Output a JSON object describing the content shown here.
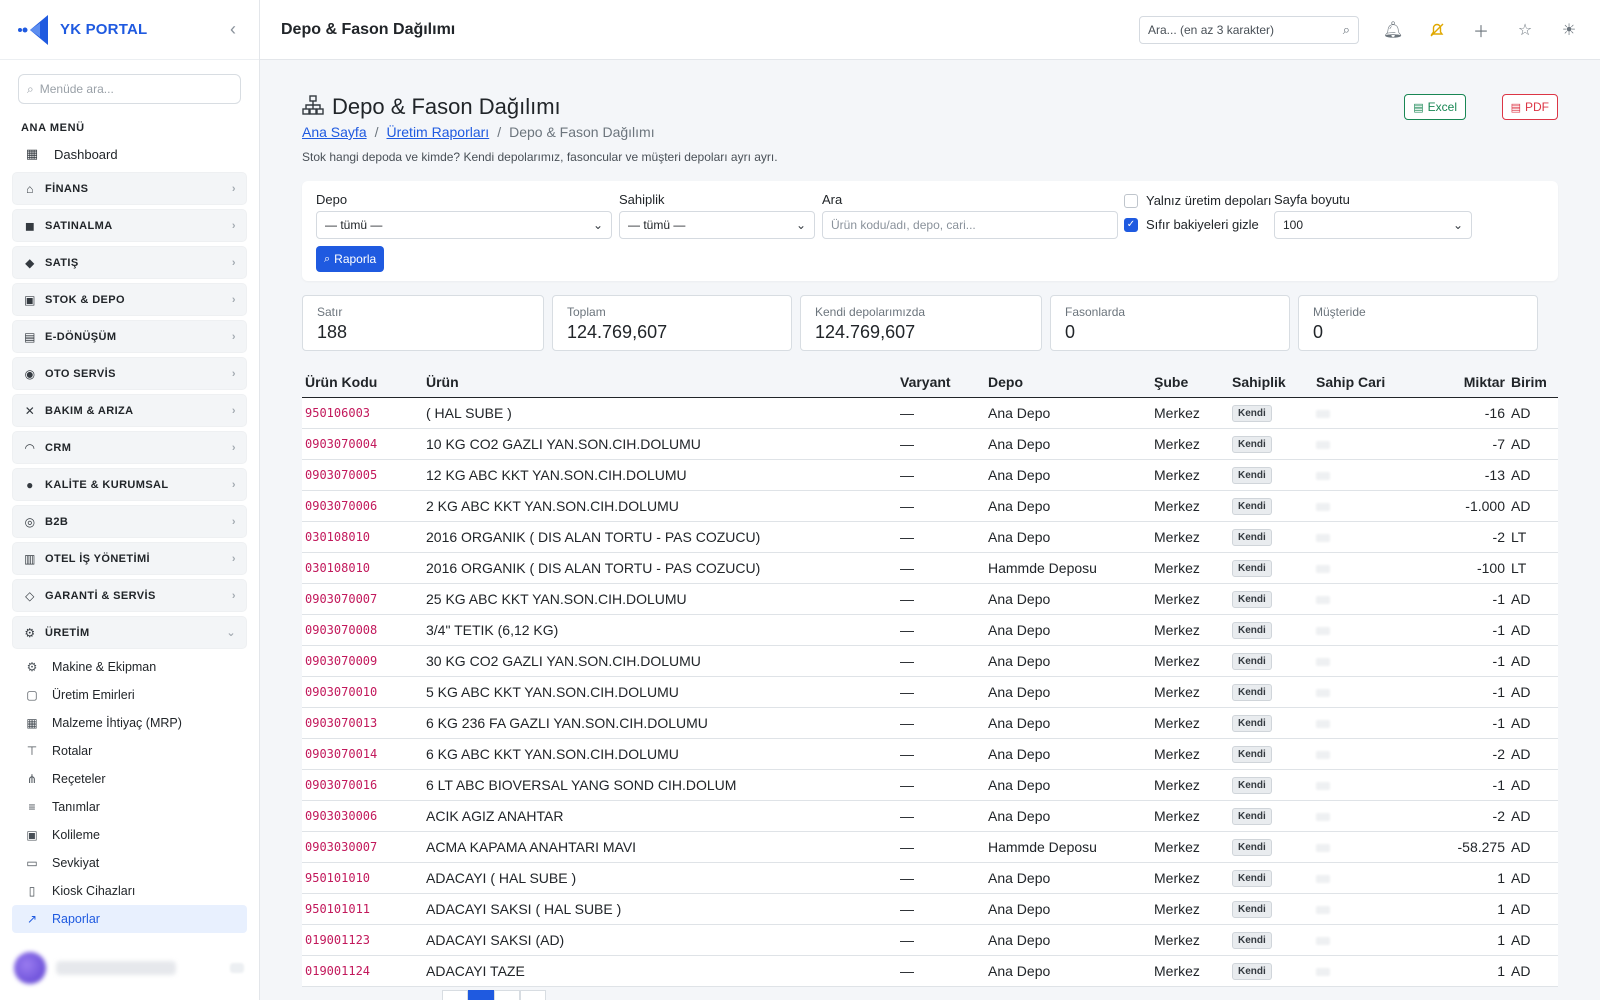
{
  "brand": {
    "name": "YK PORTAL"
  },
  "sidebar": {
    "search_placeholder": "Menüde ara...",
    "section": "ANA MENÜ",
    "dashboard": "Dashboard",
    "groups": [
      {
        "label": "FİNANS",
        "icon": "bank-icon"
      },
      {
        "label": "SATINALMA",
        "icon": "bag-icon"
      },
      {
        "label": "SATIŞ",
        "icon": "tag-icon"
      },
      {
        "label": "STOK & DEPO",
        "icon": "box-icon"
      },
      {
        "label": "E-DÖNÜŞÜM",
        "icon": "receipt-icon"
      },
      {
        "label": "OTO SERVİS",
        "icon": "car-icon"
      },
      {
        "label": "BAKIM & ARIZA",
        "icon": "wrench-icon"
      },
      {
        "label": "CRM",
        "icon": "headset-icon"
      },
      {
        "label": "KALİTE & KURUMSAL",
        "icon": "patch-check-icon"
      },
      {
        "label": "B2B",
        "icon": "globe-icon"
      },
      {
        "label": "OTEL İŞ YÖNETİMİ",
        "icon": "building-icon"
      },
      {
        "label": "GARANTİ & SERVİS",
        "icon": "shield-icon"
      },
      {
        "label": "ÜRETİM",
        "icon": "gear-icon"
      }
    ],
    "sub_items": [
      {
        "label": "Makine & Ekipman",
        "icon": "cog-icon"
      },
      {
        "label": "Üretim Emirleri",
        "icon": "clipboard-icon"
      },
      {
        "label": "Malzeme İhtiyaç (MRP)",
        "icon": "calculator-icon"
      },
      {
        "label": "Rotalar",
        "icon": "signpost-icon"
      },
      {
        "label": "Reçeteler",
        "icon": "diagram-icon"
      },
      {
        "label": "Tanımlar",
        "icon": "sliders-icon"
      },
      {
        "label": "Kolileme",
        "icon": "package-icon"
      },
      {
        "label": "Sevkiyat",
        "icon": "truck-icon"
      },
      {
        "label": "Kiosk Cihazları",
        "icon": "tablet-icon"
      },
      {
        "label": "Raporlar",
        "icon": "chart-icon"
      }
    ]
  },
  "topbar": {
    "title": "Depo & Fason Dağılımı",
    "search_placeholder": "Ara... (en az 3 karakter)"
  },
  "page": {
    "title": "Depo & Fason Dağılımı",
    "breadcrumb": {
      "home": "Ana Sayfa",
      "parent": "Üretim Raporları",
      "current": "Depo & Fason Dağılımı"
    },
    "description": "Stok hangi depoda ve kimde? Kendi depolarımız, fasoncular ve müşteri depoları ayrı ayrı.",
    "excel_label": "Excel",
    "pdf_label": "PDF"
  },
  "filters": {
    "depo_label": "Depo",
    "depo_value": "— tümü —",
    "sahiplik_label": "Sahiplik",
    "sahiplik_value": "— tümü —",
    "ara_label": "Ara",
    "ara_placeholder": "Ürün kodu/adı, depo, cari...",
    "only_production_label": "Yalnız üretim depoları",
    "only_production_checked": false,
    "hide_zero_label": "Sıfır bakiyeleri gizle",
    "hide_zero_checked": true,
    "page_size_label": "Sayfa boyutu",
    "page_size_value": "100",
    "report_button": "Raporla"
  },
  "stats": [
    {
      "label": "Satır",
      "value": "188"
    },
    {
      "label": "Toplam",
      "value": "124.769,607"
    },
    {
      "label": "Kendi depolarımızda",
      "value": "124.769,607"
    },
    {
      "label": "Fasonlarda",
      "value": "0"
    },
    {
      "label": "Müşteride",
      "value": "0"
    }
  ],
  "table": {
    "headers": [
      "Ürün Kodu",
      "Ürün",
      "Varyant",
      "Depo",
      "Şube",
      "Sahiplik",
      "Sahip Cari",
      "Miktar",
      "Birim"
    ],
    "rows": [
      {
        "code": "950106003",
        "product": "( HAL SUBE )",
        "variant": "—",
        "depo": "Ana Depo",
        "sube": "Merkez",
        "sahiplik": "Kendi",
        "qty": "-16",
        "unit": "AD"
      },
      {
        "code": "0903070004",
        "product": "10 KG CO2 GAZLI YAN.SON.CIH.DOLUMU",
        "variant": "—",
        "depo": "Ana Depo",
        "sube": "Merkez",
        "sahiplik": "Kendi",
        "qty": "-7",
        "unit": "AD"
      },
      {
        "code": "0903070005",
        "product": "12 KG ABC KKT YAN.SON.CIH.DOLUMU",
        "variant": "—",
        "depo": "Ana Depo",
        "sube": "Merkez",
        "sahiplik": "Kendi",
        "qty": "-13",
        "unit": "AD"
      },
      {
        "code": "0903070006",
        "product": "2 KG ABC KKT YAN.SON.CIH.DOLUMU",
        "variant": "—",
        "depo": "Ana Depo",
        "sube": "Merkez",
        "sahiplik": "Kendi",
        "qty": "-1.000",
        "unit": "AD"
      },
      {
        "code": "030108010",
        "product": "2016 ORGANIK ( DIS ALAN TORTU - PAS COZUCU)",
        "variant": "—",
        "depo": "Ana Depo",
        "sube": "Merkez",
        "sahiplik": "Kendi",
        "qty": "-2",
        "unit": "LT"
      },
      {
        "code": "030108010",
        "product": "2016 ORGANIK ( DIS ALAN TORTU - PAS COZUCU)",
        "variant": "—",
        "depo": "Hammde Deposu",
        "sube": "Merkez",
        "sahiplik": "Kendi",
        "qty": "-100",
        "unit": "LT"
      },
      {
        "code": "0903070007",
        "product": "25 KG ABC KKT YAN.SON.CIH.DOLUMU",
        "variant": "—",
        "depo": "Ana Depo",
        "sube": "Merkez",
        "sahiplik": "Kendi",
        "qty": "-1",
        "unit": "AD"
      },
      {
        "code": "0903070008",
        "product": "3/4\" TETIK (6,12 KG)",
        "variant": "—",
        "depo": "Ana Depo",
        "sube": "Merkez",
        "sahiplik": "Kendi",
        "qty": "-1",
        "unit": "AD"
      },
      {
        "code": "0903070009",
        "product": "30 KG CO2 GAZLI YAN.SON.CIH.DOLUMU",
        "variant": "—",
        "depo": "Ana Depo",
        "sube": "Merkez",
        "sahiplik": "Kendi",
        "qty": "-1",
        "unit": "AD"
      },
      {
        "code": "0903070010",
        "product": "5 KG ABC KKT YAN.SON.CIH.DOLUMU",
        "variant": "—",
        "depo": "Ana Depo",
        "sube": "Merkez",
        "sahiplik": "Kendi",
        "qty": "-1",
        "unit": "AD"
      },
      {
        "code": "0903070013",
        "product": "6 KG 236 FA GAZLI YAN.SON.CIH.DOLUMU",
        "variant": "—",
        "depo": "Ana Depo",
        "sube": "Merkez",
        "sahiplik": "Kendi",
        "qty": "-1",
        "unit": "AD"
      },
      {
        "code": "0903070014",
        "product": "6 KG ABC KKT YAN.SON.CIH.DOLUMU",
        "variant": "—",
        "depo": "Ana Depo",
        "sube": "Merkez",
        "sahiplik": "Kendi",
        "qty": "-2",
        "unit": "AD"
      },
      {
        "code": "0903070016",
        "product": "6 LT ABC BIOVERSAL YANG SOND CIH.DOLUM",
        "variant": "—",
        "depo": "Ana Depo",
        "sube": "Merkez",
        "sahiplik": "Kendi",
        "qty": "-1",
        "unit": "AD"
      },
      {
        "code": "0903030006",
        "product": "ACIK AGIZ ANAHTAR",
        "variant": "—",
        "depo": "Ana Depo",
        "sube": "Merkez",
        "sahiplik": "Kendi",
        "qty": "-2",
        "unit": "AD"
      },
      {
        "code": "0903030007",
        "product": "ACMA KAPAMA ANAHTARI MAVI",
        "variant": "—",
        "depo": "Hammde Deposu",
        "sube": "Merkez",
        "sahiplik": "Kendi",
        "qty": "-58.275",
        "unit": "AD"
      },
      {
        "code": "950101010",
        "product": "ADACAYI ( HAL SUBE )",
        "variant": "—",
        "depo": "Ana Depo",
        "sube": "Merkez",
        "sahiplik": "Kendi",
        "qty": "1",
        "unit": "AD"
      },
      {
        "code": "950101011",
        "product": "ADACAYI SAKSI ( HAL SUBE )",
        "variant": "—",
        "depo": "Ana Depo",
        "sube": "Merkez",
        "sahiplik": "Kendi",
        "qty": "1",
        "unit": "AD"
      },
      {
        "code": "019001123",
        "product": "ADACAYI SAKSI (AD)",
        "variant": "—",
        "depo": "Ana Depo",
        "sube": "Merkez",
        "sahiplik": "Kendi",
        "qty": "1",
        "unit": "AD"
      },
      {
        "code": "019001124",
        "product": "ADACAYI TAZE",
        "variant": "—",
        "depo": "Ana Depo",
        "sube": "Merkez",
        "sahiplik": "Kendi",
        "qty": "1",
        "unit": "AD"
      }
    ]
  },
  "colors": {
    "accent": "#1f5ae0",
    "code_text": "#c2185b",
    "excel": "#198754",
    "pdf": "#dc3545"
  }
}
